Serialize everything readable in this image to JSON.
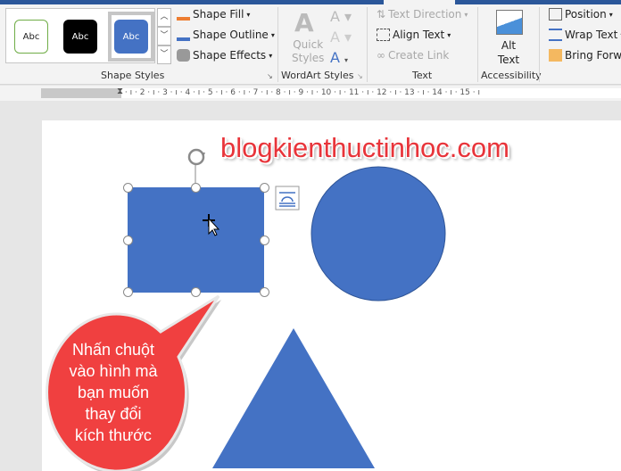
{
  "ribbon": {
    "shape_styles": {
      "swatches": [
        "Abc",
        "Abc",
        "Abc"
      ],
      "shape_fill": "Shape Fill",
      "shape_outline": "Shape Outline",
      "shape_effects": "Shape Effects",
      "label": "Shape Styles"
    },
    "wordart_styles": {
      "quick_styles_line1": "Quick",
      "quick_styles_line2": "Styles",
      "label": "WordArt Styles"
    },
    "text": {
      "text_direction": "Text Direction",
      "align_text": "Align Text",
      "create_link": "Create Link",
      "label": "Text"
    },
    "accessibility": {
      "alt_text_line1": "Alt",
      "alt_text_line2": "Text",
      "label": "Accessibility"
    },
    "arrange": {
      "position": "Position",
      "wrap_text": "Wrap Text",
      "bring_forward": "Bring Forwa"
    }
  },
  "ruler": {
    "ticks": "· 2 · ı · 1 · ı ·   · ı · 1 · ı · 2 · ı · 3 · ı · 4 · ı · 5 · ı · 6 · ı · 7 · ı · 8 · ı · 9 · ı · 10 · ı · 11 · ı · 12 · ı · 13 · ı · 14 · ı · 15 · ı"
  },
  "document": {
    "watermark": "blogkienthuctinhoc.com",
    "callout_lines": [
      "Nhấn chuột",
      "vào hình mà",
      "bạn muốn",
      "thay đổi",
      "kích thước"
    ],
    "colors": {
      "shape_blue": "#4472c4",
      "callout_red": "#f04040",
      "accent": "#2b579a"
    }
  }
}
